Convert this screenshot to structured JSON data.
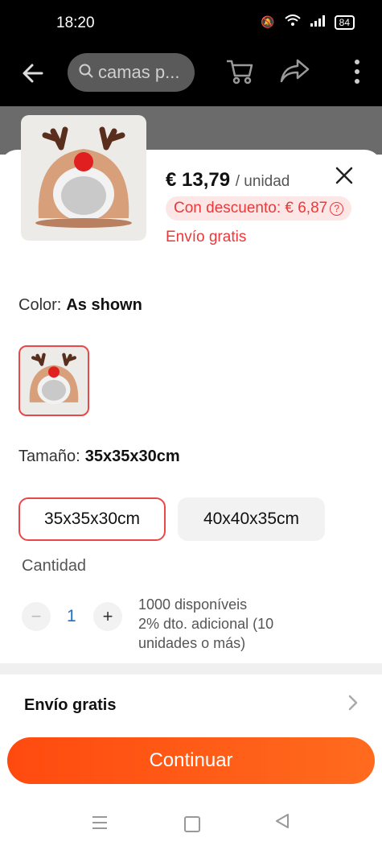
{
  "status": {
    "time": "18:20",
    "battery": "84"
  },
  "topbar": {
    "search_placeholder": "camas p..."
  },
  "product": {
    "price": "€ 13,79",
    "unit": "/ unidad",
    "discount": "Con descuento: € 6,87",
    "discount_help": "?",
    "shipping": "Envío gratis"
  },
  "color": {
    "label": "Color:",
    "value": "As shown"
  },
  "size": {
    "label": "Tamaño:",
    "value": "35x35x30cm",
    "options": [
      "35x35x30cm",
      "40x40x35cm"
    ]
  },
  "quantity": {
    "label": "Cantidad",
    "value": "1",
    "minus": "−",
    "plus": "+",
    "stock": "1000 disponíveis",
    "bulk_discount": "2% dto. adicional (10 unidades o más)"
  },
  "shipping_row": {
    "label": "Envío gratis"
  },
  "cta": {
    "label": "Continuar"
  },
  "colors": {
    "accent": "#ff4a0f",
    "price_red": "#e83a3a"
  }
}
